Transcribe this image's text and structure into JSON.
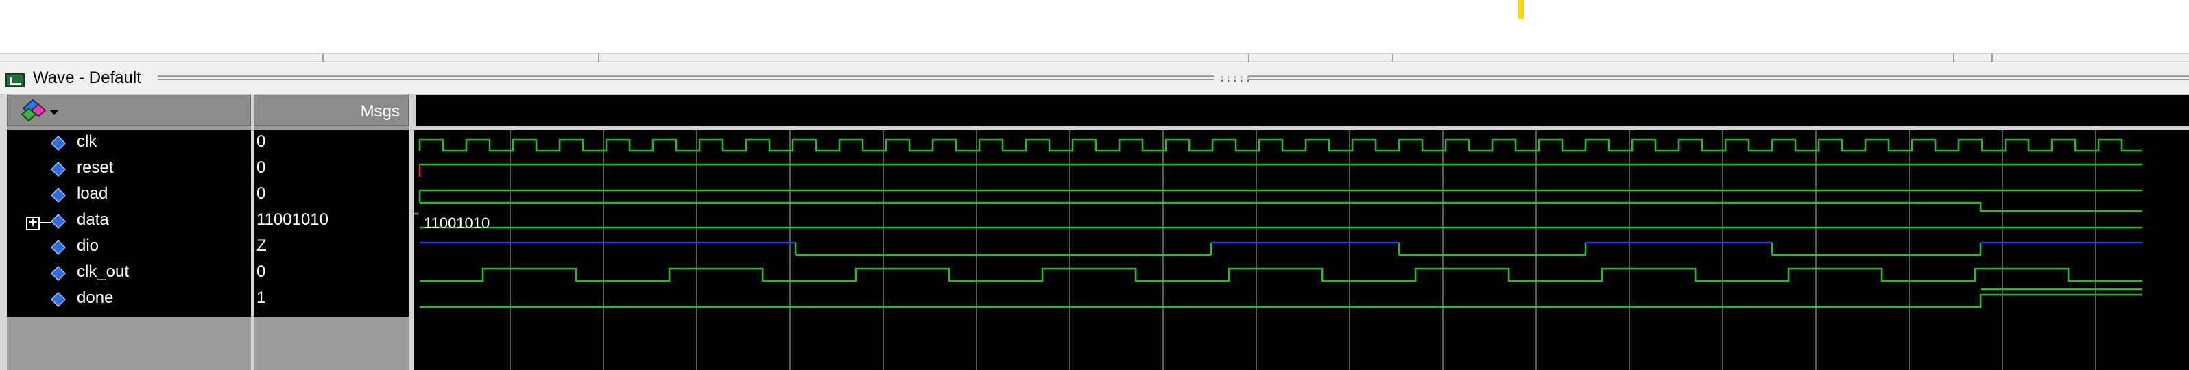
{
  "window": {
    "title": "Wave - Default",
    "gripper": ":::::"
  },
  "header": {
    "msgs_label": "Msgs"
  },
  "icons": {
    "window_icon": "wave-window-icon",
    "cursor_icon": "wave-cursor-icon",
    "dropdown_icon": "chevron-down-icon",
    "signal_icon": "diamond-signal-icon",
    "expand_icon": "expand-plus-icon"
  },
  "signals": [
    {
      "name": "clk",
      "value": "0"
    },
    {
      "name": "reset",
      "value": "0"
    },
    {
      "name": "load",
      "value": "0"
    },
    {
      "name": "data",
      "value": "11001010",
      "expandable": true,
      "wave_text": "11001010"
    },
    {
      "name": "dio",
      "value": "Z"
    },
    {
      "name": "clk_out",
      "value": "0"
    },
    {
      "name": "done",
      "value": "1"
    }
  ],
  "colors": {
    "wave_green": "#20c020",
    "wave_blue": "#1e3cff",
    "grid": "#5a5a5a",
    "background": "#000000",
    "highlight": "#ffd900"
  }
}
